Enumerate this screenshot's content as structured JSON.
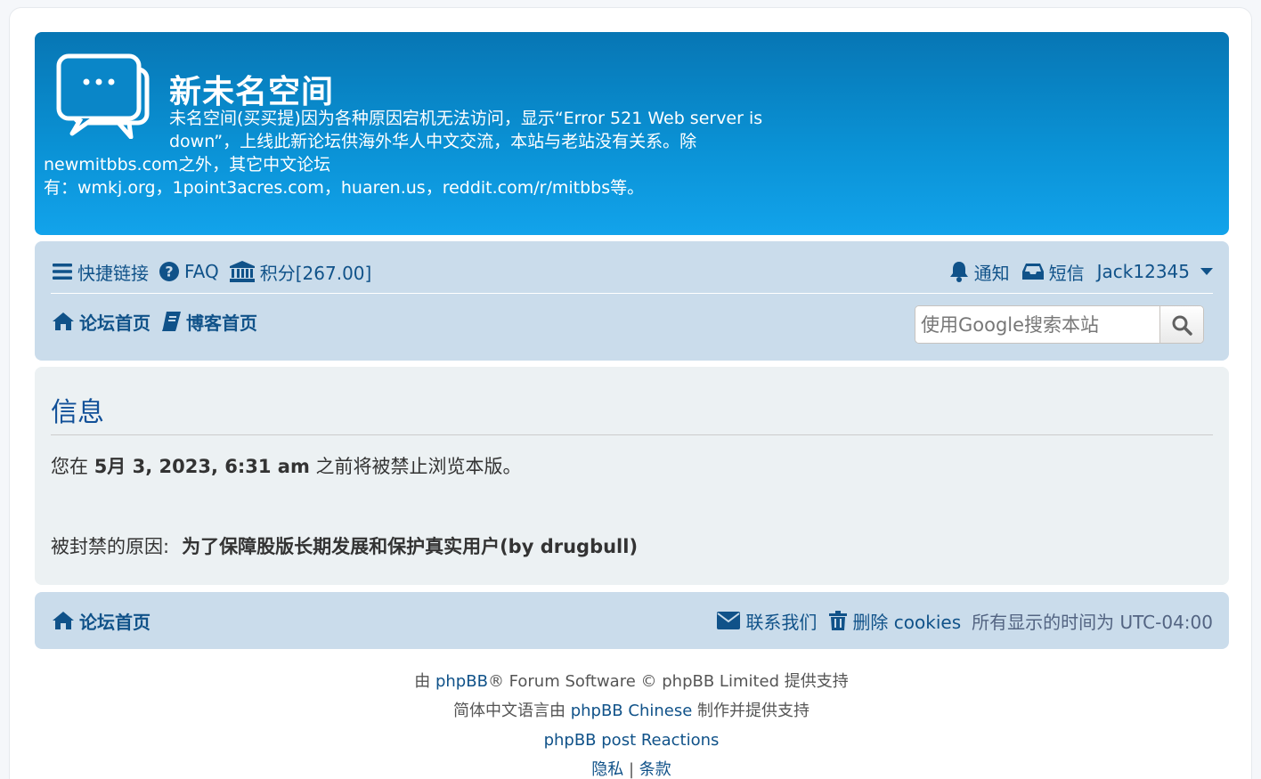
{
  "header": {
    "title": "新未名空间",
    "desc_line1": "未名空间(买买提)因为各种原因宕机无法访问，显示“Error 521 Web server is",
    "desc_line2": "down”，上线此新论坛供海外华人中文交流，本站与老站没有关系。除",
    "desc_line3": "newmitbbs.com之外，其它中文论坛",
    "desc_line4": "有：wmkj.org，1point3acres.com，huaren.us，reddit.com/r/mitbbs等。"
  },
  "nav": {
    "quick_links": "快捷链接",
    "faq": "FAQ",
    "points": "积分[267.00]",
    "notifications": "通知",
    "messages": "短信",
    "username": "Jack12345",
    "forum_home": "论坛首页",
    "blog_home": "博客首页"
  },
  "search": {
    "placeholder": "使用Google搜索本站"
  },
  "message": {
    "heading": "信息",
    "prefix": "您在",
    "date": "5月 3, 2023, 6:31 am",
    "suffix": "之前将被禁止浏览本版。",
    "reason_label": "被封禁的原因:",
    "reason": "为了保障股版长期发展和保护真实用户(by drugbull)"
  },
  "footer_nav": {
    "forum_home": "论坛首页",
    "contact": "联系我们",
    "delete_cookies": "删除 cookies",
    "timezone": "所有显示的时间为 UTC-04:00"
  },
  "copyright": {
    "by": "由",
    "phpbb": "phpBB",
    "forum_software": "® Forum Software © phpBB Limited 提供支持",
    "chinese_prefix": "简体中文语言由",
    "phpbb_chinese": "phpBB Chinese",
    "chinese_suffix": "制作并提供支持",
    "reactions": "phpBB post Reactions",
    "privacy": "隐私",
    "sep": "|",
    "terms": "条款"
  },
  "colors": {
    "header_top": "#0776b4",
    "header_bottom": "#12a3eb",
    "navbar_bg": "#cadceb",
    "link": "#105289",
    "panel_bg": "#ecf1f3"
  }
}
